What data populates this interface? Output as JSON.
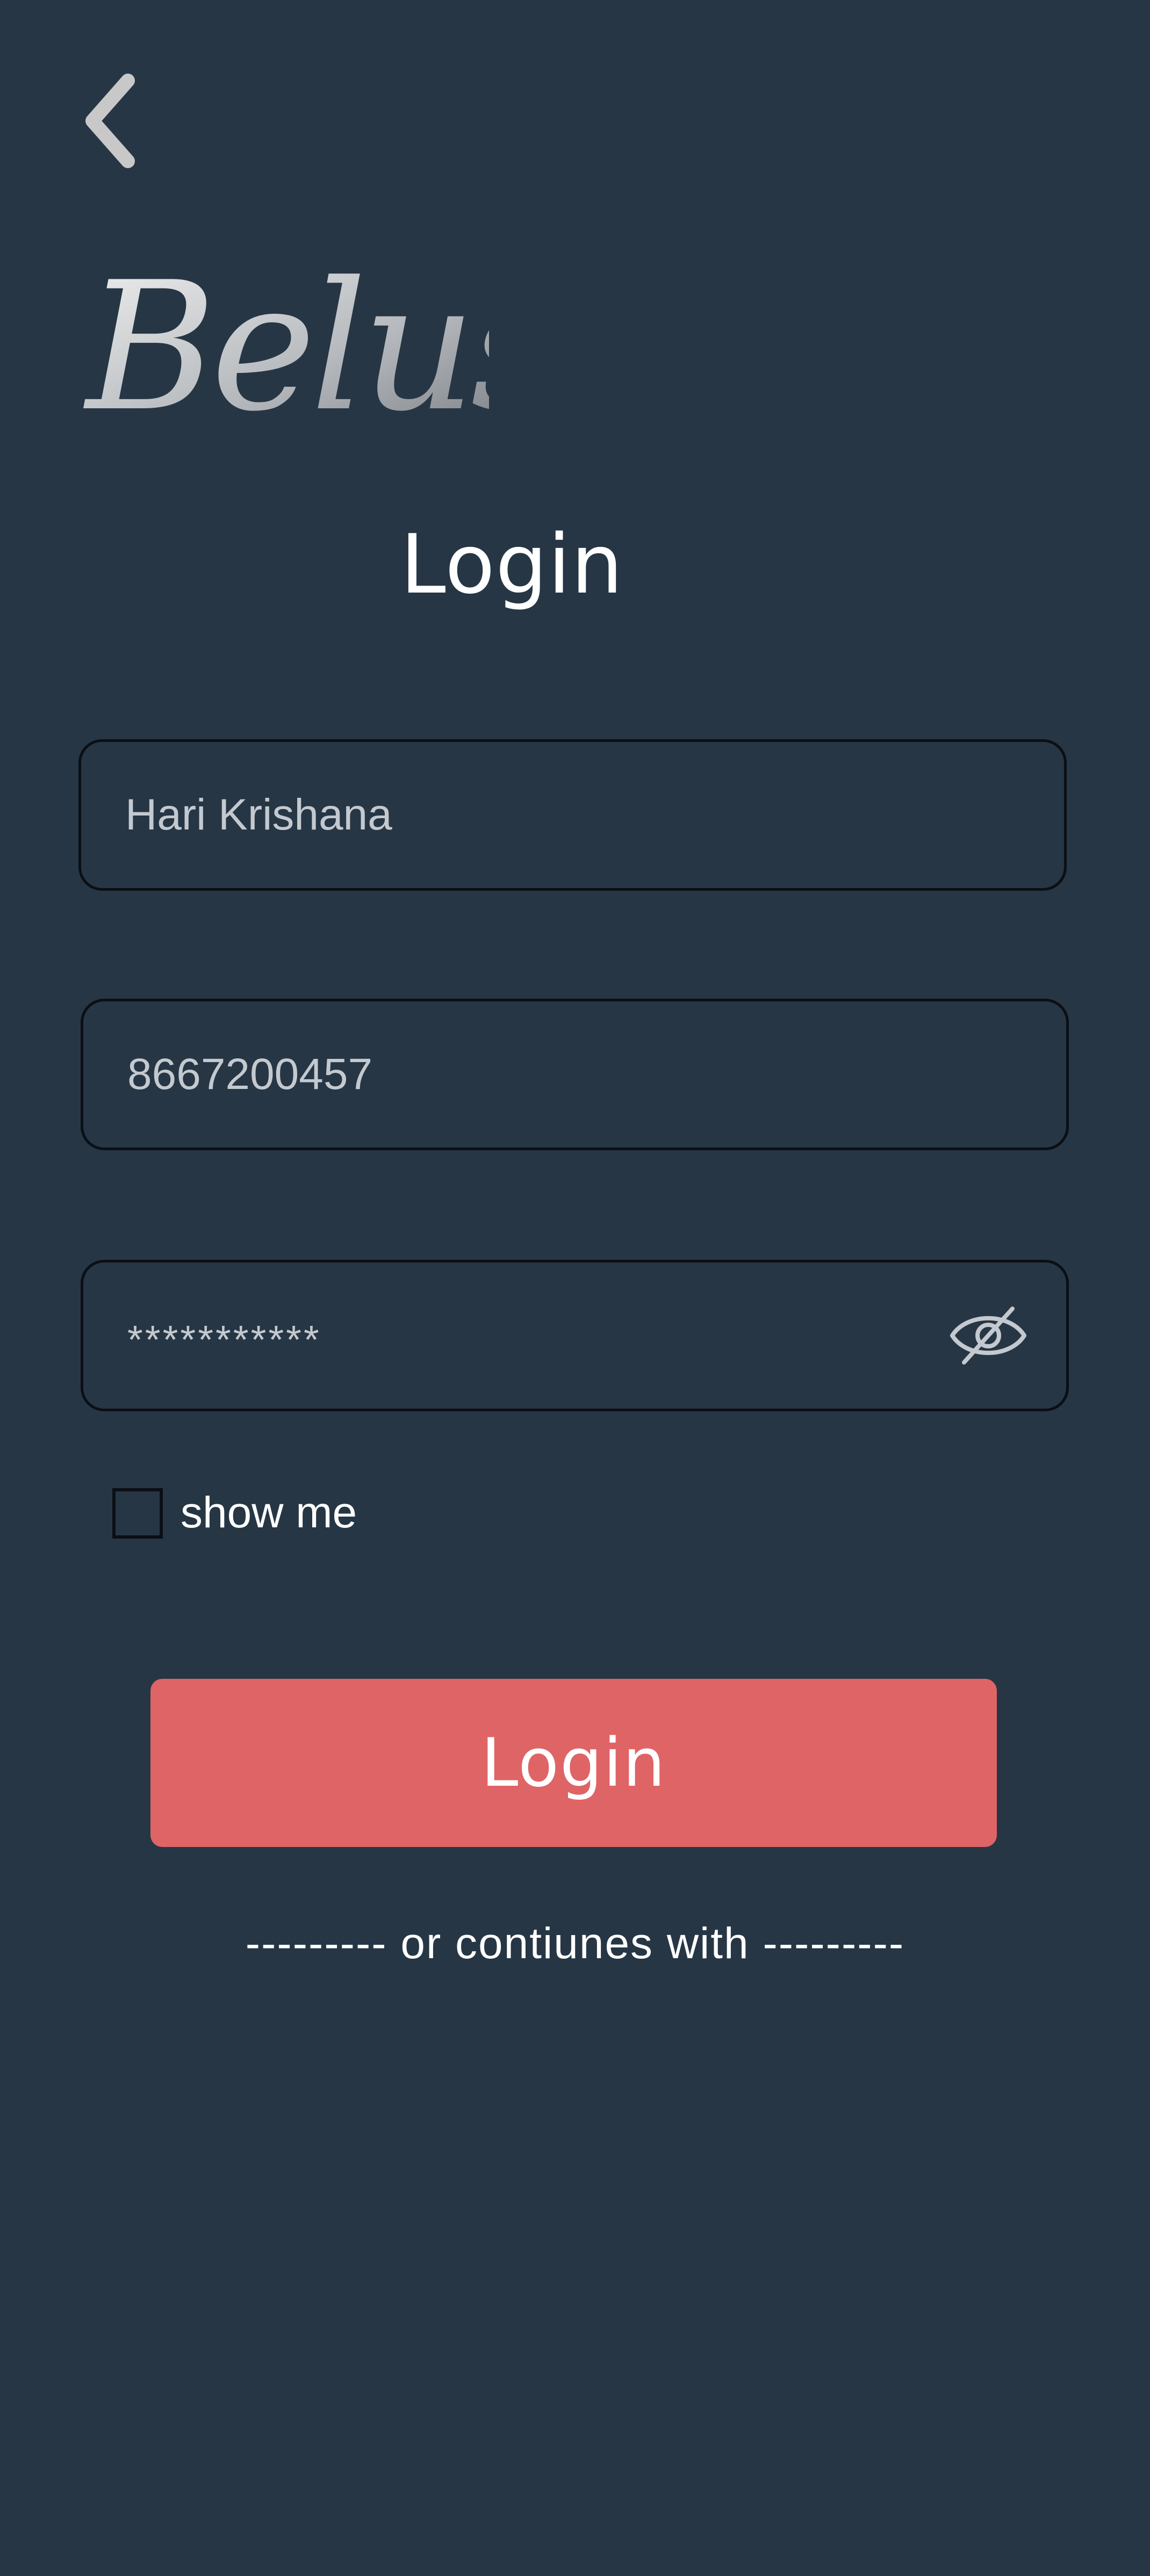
{
  "header": {
    "back_icon": "chevron-left-icon",
    "logo_text": "Belus"
  },
  "title": "Login",
  "form": {
    "name_value": "Hari Krishana",
    "phone_value": "8667200457",
    "password_value": "***********",
    "password_toggle_icon": "eye-off-icon",
    "show_me_label": "show me",
    "show_me_checked": false
  },
  "login_button_label": "Login",
  "divider_text": "--------- or contiunes with ---------",
  "colors": {
    "background": "#263645",
    "accent": "#df6466",
    "field_border": "#0b0f14",
    "field_text": "#c3c9cf",
    "text": "#ffffff"
  }
}
